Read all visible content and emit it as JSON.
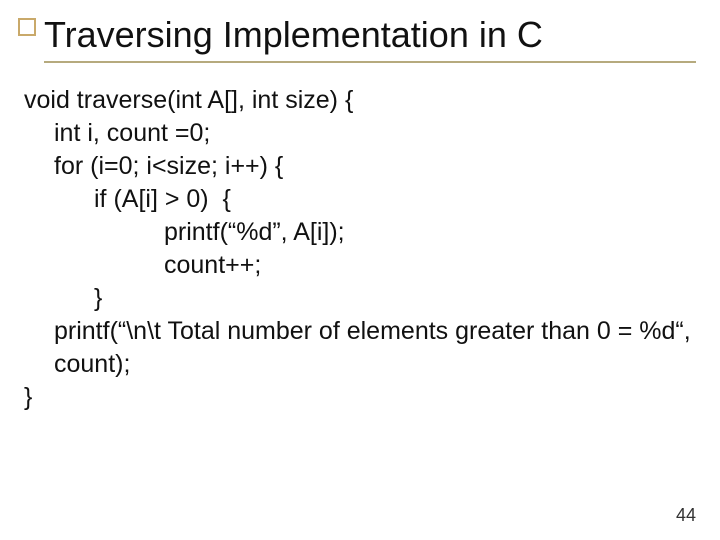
{
  "title": "Traversing Implementation in C",
  "code": {
    "l0": "void traverse(int A[], int size) {",
    "l1": "int i, count =0;",
    "l2": "for (i=0; i<size; i++) {",
    "l3": "if (A[i] > 0)  {",
    "l4": "printf(“%d”, A[i]);",
    "l5": "count++;",
    "l6": "}",
    "l7": "printf(“\\n\\t Total number of elements greater than 0 = %d“, count);",
    "l8": "}"
  },
  "page_number": "44"
}
